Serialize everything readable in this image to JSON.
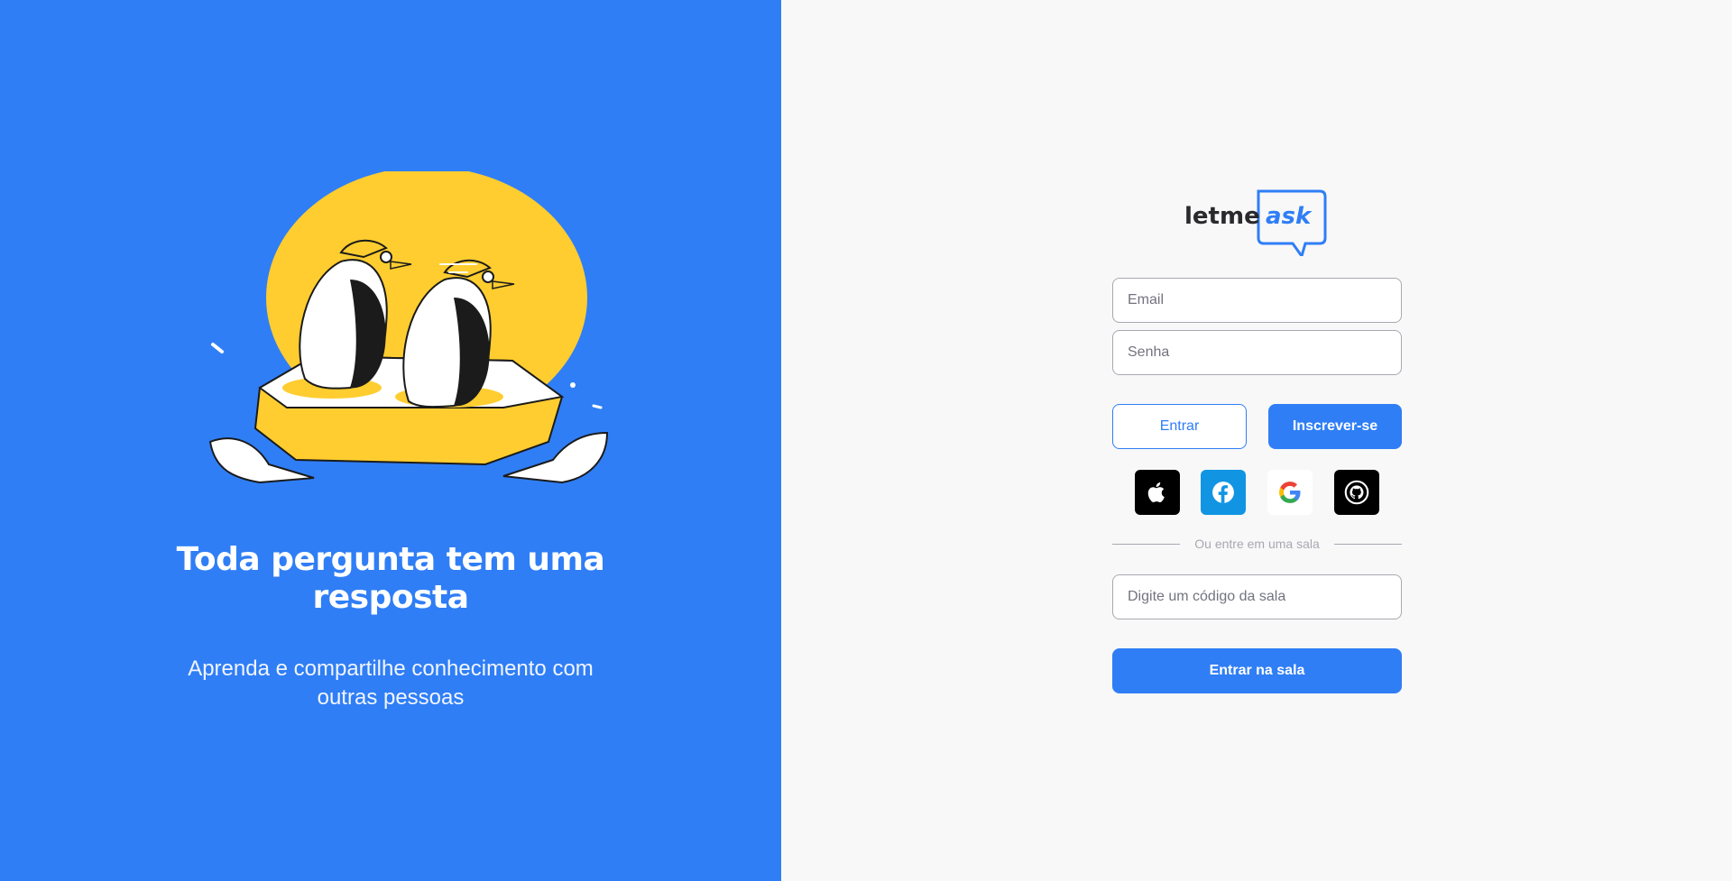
{
  "hero": {
    "title_line1": "Toda pergunta tem uma",
    "title_line2": "resposta",
    "subtitle_line1": "Aprenda e compartilhe conhecimento com",
    "subtitle_line2": "outras pessoas"
  },
  "logo": {
    "word1": "letme",
    "word2": "ask"
  },
  "form": {
    "email_placeholder": "Email",
    "password_placeholder": "Senha",
    "login_label": "Entrar",
    "signup_label": "Inscrever-se",
    "divider_label": "Ou entre em uma sala",
    "room_code_placeholder": "Digite um código da sala",
    "join_room_label": "Entrar na sala"
  },
  "social": [
    {
      "name": "apple-icon",
      "bg": "#000000"
    },
    {
      "name": "facebook-icon",
      "bg": "#1195e3"
    },
    {
      "name": "google-icon",
      "bg": "#ffffff"
    },
    {
      "name": "github-icon",
      "bg": "#000000"
    }
  ],
  "colors": {
    "primary": "#2f7ef6",
    "accent_yellow": "#ffcd2f",
    "background": "#f8f8f8"
  }
}
